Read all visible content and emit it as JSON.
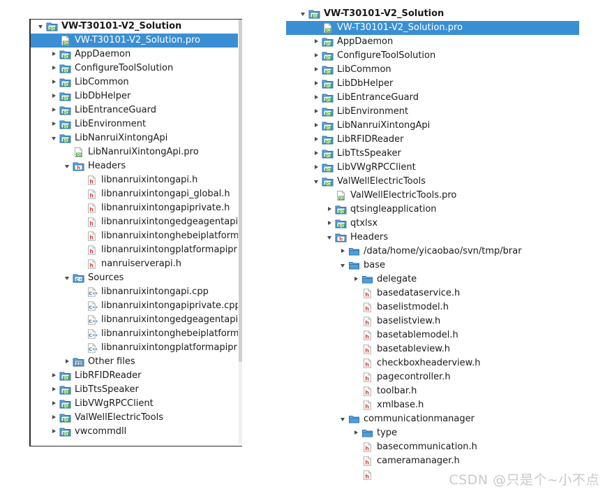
{
  "watermark": {
    "text": "CSDN @只是个~小不点"
  },
  "colors": {
    "selection": "#3a8fd4",
    "selection_text": "#ffffff",
    "text": "#1a1a1a",
    "qt_folder_green": "#3fa535",
    "folder_blue": "#4a90d9",
    "header_red": "#d04437",
    "source_blue": "#2f6fa8",
    "panel_border": "#2b2b2b",
    "scroll_thumb": "#cfcfcf"
  },
  "left_panel": {
    "name": "project-tree-left",
    "rows": [
      {
        "indent": 0,
        "arrow": "expanded",
        "icon": "qt-project-folder-icon",
        "label": "VW-T30101-V2_Solution",
        "bold": true,
        "selected": false
      },
      {
        "indent": 1,
        "arrow": "none",
        "icon": "qt-pro-file-icon",
        "label": "VW-T30101-V2_Solution.pro",
        "bold": false,
        "selected": true
      },
      {
        "indent": 1,
        "arrow": "collapsed",
        "icon": "qt-project-folder-icon",
        "label": "AppDaemon",
        "bold": false,
        "selected": false
      },
      {
        "indent": 1,
        "arrow": "collapsed",
        "icon": "qt-project-folder-icon",
        "label": "ConfigureToolSolution",
        "bold": false,
        "selected": false
      },
      {
        "indent": 1,
        "arrow": "collapsed",
        "icon": "qt-project-folder-icon",
        "label": "LibCommon",
        "bold": false,
        "selected": false
      },
      {
        "indent": 1,
        "arrow": "collapsed",
        "icon": "qt-project-folder-icon",
        "label": "LibDbHelper",
        "bold": false,
        "selected": false
      },
      {
        "indent": 1,
        "arrow": "collapsed",
        "icon": "qt-project-folder-icon",
        "label": "LibEntranceGuard",
        "bold": false,
        "selected": false
      },
      {
        "indent": 1,
        "arrow": "collapsed",
        "icon": "qt-project-folder-icon",
        "label": "LibEnvironment",
        "bold": false,
        "selected": false
      },
      {
        "indent": 1,
        "arrow": "expanded",
        "icon": "qt-project-folder-icon",
        "label": "LibNanruiXintongApi",
        "bold": false,
        "selected": false
      },
      {
        "indent": 2,
        "arrow": "none",
        "icon": "qt-pro-file-icon",
        "label": "LibNanruiXintongApi.pro",
        "bold": false,
        "selected": false
      },
      {
        "indent": 2,
        "arrow": "expanded",
        "icon": "headers-folder-icon",
        "label": "Headers",
        "bold": false,
        "selected": false
      },
      {
        "indent": 3,
        "arrow": "none",
        "icon": "header-file-icon",
        "label": "libnanruixintongapi.h",
        "bold": false,
        "selected": false
      },
      {
        "indent": 3,
        "arrow": "none",
        "icon": "header-file-icon",
        "label": "libnanruixintongapi_global.h",
        "bold": false,
        "selected": false
      },
      {
        "indent": 3,
        "arrow": "none",
        "icon": "header-file-icon",
        "label": "libnanruixintongapiprivate.h",
        "bold": false,
        "selected": false
      },
      {
        "indent": 3,
        "arrow": "none",
        "icon": "header-file-icon",
        "label": "libnanruixintongedgeagentapiprivate.h",
        "bold": false,
        "selected": false
      },
      {
        "indent": 3,
        "arrow": "none",
        "icon": "header-file-icon",
        "label": "libnanruixintonghebeiplatformapiprivate.h",
        "bold": false,
        "selected": false
      },
      {
        "indent": 3,
        "arrow": "none",
        "icon": "header-file-icon",
        "label": "libnanruixintongplatformapiprivate.h",
        "bold": false,
        "selected": false
      },
      {
        "indent": 3,
        "arrow": "none",
        "icon": "header-file-icon",
        "label": "nanruiserverapi.h",
        "bold": false,
        "selected": false
      },
      {
        "indent": 2,
        "arrow": "expanded",
        "icon": "sources-folder-icon",
        "label": "Sources",
        "bold": false,
        "selected": false
      },
      {
        "indent": 3,
        "arrow": "none",
        "icon": "cpp-file-icon",
        "label": "libnanruixintongapi.cpp",
        "bold": false,
        "selected": false
      },
      {
        "indent": 3,
        "arrow": "none",
        "icon": "cpp-file-icon",
        "label": "libnanruixintongapiprivate.cpp",
        "bold": false,
        "selected": false
      },
      {
        "indent": 3,
        "arrow": "none",
        "icon": "cpp-file-icon",
        "label": "libnanruixintongedgeagentapiprivate.cpp",
        "bold": false,
        "selected": false
      },
      {
        "indent": 3,
        "arrow": "none",
        "icon": "cpp-file-icon",
        "label": "libnanruixintonghebeiplatformapiprivate.cpp",
        "bold": false,
        "selected": false
      },
      {
        "indent": 3,
        "arrow": "none",
        "icon": "cpp-file-icon",
        "label": "libnanruixintongplatformapiprivate.cpp",
        "bold": false,
        "selected": false
      },
      {
        "indent": 2,
        "arrow": "collapsed",
        "icon": "other-files-folder-icon",
        "label": "Other files",
        "bold": false,
        "selected": false
      },
      {
        "indent": 1,
        "arrow": "collapsed",
        "icon": "qt-project-folder-icon",
        "label": "LibRFIDReader",
        "bold": false,
        "selected": false
      },
      {
        "indent": 1,
        "arrow": "collapsed",
        "icon": "qt-project-folder-icon",
        "label": "LibTtsSpeaker",
        "bold": false,
        "selected": false
      },
      {
        "indent": 1,
        "arrow": "collapsed",
        "icon": "qt-project-folder-icon",
        "label": "LibVWgRPCClient",
        "bold": false,
        "selected": false
      },
      {
        "indent": 1,
        "arrow": "collapsed",
        "icon": "qt-project-folder-icon",
        "label": "ValWellElectricTools",
        "bold": false,
        "selected": false
      },
      {
        "indent": 1,
        "arrow": "collapsed",
        "icon": "qt-project-folder-icon",
        "label": "vwcommdll",
        "bold": false,
        "selected": false
      }
    ]
  },
  "right_panel": {
    "name": "project-tree-right",
    "rows": [
      {
        "indent": 0,
        "arrow": "expanded",
        "icon": "qt-project-folder-icon",
        "label": "VW-T30101-V2_Solution",
        "bold": true,
        "selected": false
      },
      {
        "indent": 1,
        "arrow": "none",
        "icon": "qt-pro-file-icon",
        "label": "VW-T30101-V2_Solution.pro",
        "bold": false,
        "selected": true
      },
      {
        "indent": 1,
        "arrow": "collapsed",
        "icon": "qt-project-folder-icon",
        "label": "AppDaemon",
        "bold": false,
        "selected": false
      },
      {
        "indent": 1,
        "arrow": "collapsed",
        "icon": "qt-project-folder-icon",
        "label": "ConfigureToolSolution",
        "bold": false,
        "selected": false
      },
      {
        "indent": 1,
        "arrow": "collapsed",
        "icon": "qt-project-folder-icon",
        "label": "LibCommon",
        "bold": false,
        "selected": false
      },
      {
        "indent": 1,
        "arrow": "collapsed",
        "icon": "qt-project-folder-icon",
        "label": "LibDbHelper",
        "bold": false,
        "selected": false
      },
      {
        "indent": 1,
        "arrow": "collapsed",
        "icon": "qt-project-folder-icon",
        "label": "LibEntranceGuard",
        "bold": false,
        "selected": false
      },
      {
        "indent": 1,
        "arrow": "collapsed",
        "icon": "qt-project-folder-icon",
        "label": "LibEnvironment",
        "bold": false,
        "selected": false
      },
      {
        "indent": 1,
        "arrow": "collapsed",
        "icon": "qt-project-folder-icon",
        "label": "LibNanruiXintongApi",
        "bold": false,
        "selected": false
      },
      {
        "indent": 1,
        "arrow": "collapsed",
        "icon": "qt-project-folder-icon",
        "label": "LibRFIDReader",
        "bold": false,
        "selected": false
      },
      {
        "indent": 1,
        "arrow": "collapsed",
        "icon": "qt-project-folder-icon",
        "label": "LibTtsSpeaker",
        "bold": false,
        "selected": false
      },
      {
        "indent": 1,
        "arrow": "collapsed",
        "icon": "qt-project-folder-icon",
        "label": "LibVWgRPCClient",
        "bold": false,
        "selected": false
      },
      {
        "indent": 1,
        "arrow": "expanded",
        "icon": "qt-project-folder-icon",
        "label": "ValWellElectricTools",
        "bold": false,
        "selected": false
      },
      {
        "indent": 2,
        "arrow": "none",
        "icon": "qt-pro-file-icon",
        "label": "ValWellElectricTools.pro",
        "bold": false,
        "selected": false
      },
      {
        "indent": 2,
        "arrow": "collapsed",
        "icon": "qt-project-folder-icon",
        "label": "qtsingleapplication",
        "bold": false,
        "selected": false
      },
      {
        "indent": 2,
        "arrow": "collapsed",
        "icon": "qt-project-folder-icon",
        "label": "qtxlsx",
        "bold": false,
        "selected": false
      },
      {
        "indent": 2,
        "arrow": "expanded",
        "icon": "headers-folder-icon",
        "label": "Headers",
        "bold": false,
        "selected": false
      },
      {
        "indent": 3,
        "arrow": "collapsed",
        "icon": "plain-folder-icon",
        "label": "/data/home/yicaobao/svn/tmp/brar",
        "bold": false,
        "selected": false
      },
      {
        "indent": 3,
        "arrow": "expanded",
        "icon": "plain-folder-icon",
        "label": "base",
        "bold": false,
        "selected": false
      },
      {
        "indent": 4,
        "arrow": "collapsed",
        "icon": "plain-folder-icon",
        "label": "delegate",
        "bold": false,
        "selected": false
      },
      {
        "indent": 4,
        "arrow": "none",
        "icon": "header-file-icon",
        "label": "basedataservice.h",
        "bold": false,
        "selected": false
      },
      {
        "indent": 4,
        "arrow": "none",
        "icon": "header-file-icon",
        "label": "baselistmodel.h",
        "bold": false,
        "selected": false
      },
      {
        "indent": 4,
        "arrow": "none",
        "icon": "header-file-icon",
        "label": "baselistview.h",
        "bold": false,
        "selected": false
      },
      {
        "indent": 4,
        "arrow": "none",
        "icon": "header-file-icon",
        "label": "basetablemodel.h",
        "bold": false,
        "selected": false
      },
      {
        "indent": 4,
        "arrow": "none",
        "icon": "header-file-icon",
        "label": "basetableview.h",
        "bold": false,
        "selected": false
      },
      {
        "indent": 4,
        "arrow": "none",
        "icon": "header-file-icon",
        "label": "checkboxheaderview.h",
        "bold": false,
        "selected": false
      },
      {
        "indent": 4,
        "arrow": "none",
        "icon": "header-file-icon",
        "label": "pagecontroller.h",
        "bold": false,
        "selected": false
      },
      {
        "indent": 4,
        "arrow": "none",
        "icon": "header-file-icon",
        "label": "toolbar.h",
        "bold": false,
        "selected": false
      },
      {
        "indent": 4,
        "arrow": "none",
        "icon": "header-file-icon",
        "label": "xmlbase.h",
        "bold": false,
        "selected": false
      },
      {
        "indent": 3,
        "arrow": "expanded",
        "icon": "plain-folder-icon",
        "label": "communicationmanager",
        "bold": false,
        "selected": false
      },
      {
        "indent": 4,
        "arrow": "collapsed",
        "icon": "plain-folder-icon",
        "label": "type",
        "bold": false,
        "selected": false
      },
      {
        "indent": 4,
        "arrow": "none",
        "icon": "header-file-icon",
        "label": "basecommunication.h",
        "bold": false,
        "selected": false
      },
      {
        "indent": 4,
        "arrow": "none",
        "icon": "header-file-icon",
        "label": "cameramanager.h",
        "bold": false,
        "selected": false
      },
      {
        "indent": 4,
        "arrow": "none",
        "icon": "header-file-icon",
        "label": "",
        "bold": false,
        "selected": false
      }
    ]
  }
}
